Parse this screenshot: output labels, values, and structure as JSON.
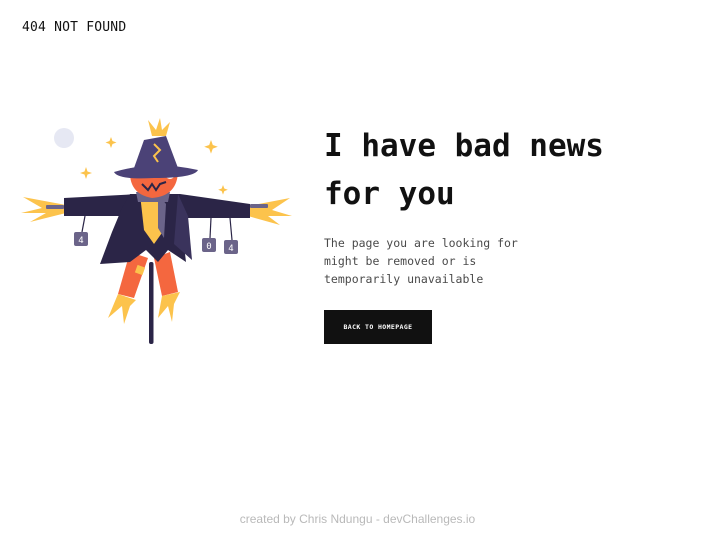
{
  "header": {
    "title": "404 NOT FOUND"
  },
  "illustration": {
    "icon": "scarecrow-illustration",
    "can_labels": [
      "4",
      "0",
      "4"
    ]
  },
  "main": {
    "headline_line1": "I have bad news",
    "headline_line2": "for you",
    "message": "The page you are looking for might be removed or is temporarily unavailable",
    "button_label": "BACK TO HOMEPAGE"
  },
  "footer": {
    "credit": "created by Chris Ndungu - devChallenges.io"
  },
  "colors": {
    "background": "#ffffff",
    "text": "#111111",
    "button_bg": "#111111",
    "button_text": "#ffffff",
    "footer_text": "#b9b9b9",
    "coat": "#2b2547",
    "hat": "#4b4277",
    "face": "#f4673f",
    "straw": "#fcc34c",
    "moon": "#e6e8f3"
  }
}
